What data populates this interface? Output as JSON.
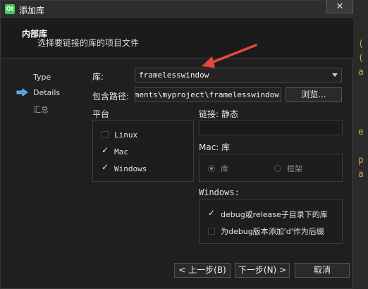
{
  "window": {
    "title": "添加库",
    "close_glyph": "✕",
    "logo_text": "Qt"
  },
  "header": {
    "title": "内部库",
    "subtitle": "选择要链接的库的项目文件"
  },
  "steps": [
    {
      "label": "Type",
      "state": "done"
    },
    {
      "label": "Details",
      "state": "current"
    },
    {
      "label": "汇总",
      "state": "pending"
    }
  ],
  "form": {
    "library_label": "库:",
    "library_value": "framelesswindow",
    "path_label": "包含路径:",
    "path_value": "ocuments\\myproject\\framelesswindow",
    "browse_label": "浏览..."
  },
  "platform": {
    "title": "平台",
    "items": [
      {
        "label": "Linux",
        "checked": false
      },
      {
        "label": "Mac",
        "checked": true
      },
      {
        "label": "Windows",
        "checked": true
      }
    ]
  },
  "linking": {
    "title": "链接: 静态"
  },
  "mac": {
    "title": "Mac: 库",
    "options": [
      {
        "label": "库",
        "checked": true
      },
      {
        "label": "框架",
        "checked": false
      }
    ]
  },
  "windows": {
    "title": "Windows:",
    "options": [
      {
        "label": "debug或release子目录下的库",
        "checked": true
      },
      {
        "label": "为debug版本添加'd'作为后缀",
        "checked": false
      }
    ]
  },
  "footer": {
    "back_label": "< 上一步(B)",
    "next_label": "下一步(N) >",
    "cancel_label": "取消"
  },
  "colors": {
    "accent_arrow": "#4a9fe8",
    "annotation_arrow": "#e8483b"
  }
}
